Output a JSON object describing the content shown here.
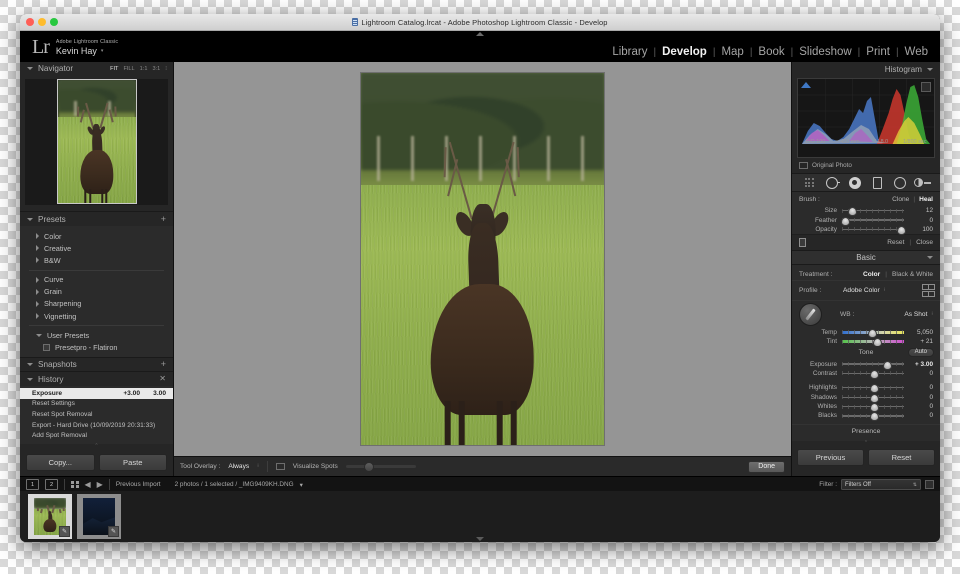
{
  "window": {
    "title": "Lightroom Catalog.lrcat - Adobe Photoshop Lightroom Classic - Develop"
  },
  "identity": {
    "logo": "Lr",
    "app_name": "Adobe Lightroom Classic",
    "user": "Kevin Hay",
    "caret": "▾"
  },
  "modules": [
    {
      "label": "Library",
      "active": false
    },
    {
      "label": "Develop",
      "active": true
    },
    {
      "label": "Map",
      "active": false
    },
    {
      "label": "Book",
      "active": false
    },
    {
      "label": "Slideshow",
      "active": false
    },
    {
      "label": "Print",
      "active": false
    },
    {
      "label": "Web",
      "active": false
    }
  ],
  "navigator": {
    "title": "Navigator",
    "zooms": [
      "FIT",
      "FILL",
      "1:1",
      "3:1"
    ],
    "active_zoom": "FIT"
  },
  "presets": {
    "title": "Presets",
    "add_label": "+",
    "groups": [
      {
        "label": "Color"
      },
      {
        "label": "Creative"
      },
      {
        "label": "B&W"
      },
      {
        "label": "Curve"
      },
      {
        "label": "Grain"
      },
      {
        "label": "Sharpening"
      },
      {
        "label": "Vignetting"
      }
    ],
    "user_presets_label": "User Presets",
    "user_presets": [
      {
        "label": "Presetpro - Flatiron"
      }
    ]
  },
  "snapshots": {
    "title": "Snapshots",
    "add_label": "+"
  },
  "history": {
    "title": "History",
    "close_label": "✕",
    "items": [
      {
        "name": "Exposure",
        "delta": "+3.00",
        "value": "3.00",
        "selected": true
      },
      {
        "name": "Reset Settings",
        "delta": "",
        "value": "",
        "selected": false
      },
      {
        "name": "Reset Spot Removal",
        "delta": "",
        "value": "",
        "selected": false
      },
      {
        "name": "Export - Hard Drive (10/09/2019 20:31:33)",
        "delta": "",
        "value": "",
        "selected": false
      },
      {
        "name": "Add Spot Removal",
        "delta": "",
        "value": "",
        "selected": false
      }
    ]
  },
  "copy_paste": {
    "copy": "Copy...",
    "paste": "Paste"
  },
  "toolbar": {
    "tool_overlay_label": "Tool Overlay :",
    "tool_overlay_value": "Always",
    "visualize_spots_label": "Visualize Spots",
    "visualize_spots_checked": false,
    "visualize_spots_slider": 33,
    "done_label": "Done"
  },
  "histogram": {
    "title": "Histogram",
    "iso": "ISO 100",
    "focal": "450 mm",
    "aperture": "f / 8.0",
    "shutter": "1/800 sec",
    "original_photo_label": "Original Photo"
  },
  "tools": {
    "icons": [
      "crop-grid-icon",
      "spot-removal-icon",
      "red-eye-icon",
      "graduated-filter-icon",
      "radial-filter-icon",
      "adjustment-brush-icon"
    ]
  },
  "brush": {
    "label": "Brush :",
    "modes": [
      {
        "label": "Clone",
        "active": false
      },
      {
        "label": "Heal",
        "active": true
      }
    ],
    "sliders": [
      {
        "label": "Size",
        "value": "12",
        "pos": 16
      },
      {
        "label": "Feather",
        "value": "0",
        "pos": 4
      },
      {
        "label": "Opacity",
        "value": "100",
        "pos": 94
      }
    ],
    "reset_label": "Reset",
    "close_label": "Close"
  },
  "basic": {
    "title": "Basic",
    "treatment_label": "Treatment :",
    "treatments": [
      {
        "label": "Color",
        "active": true
      },
      {
        "label": "Black & White",
        "active": false
      }
    ],
    "profile_label": "Profile :",
    "profile_value": "Adobe Color",
    "wb_label": "WB :",
    "wb_value": "As Shot",
    "wb_sliders": [
      {
        "label": "Temp",
        "value": "5,050",
        "pos": 48
      },
      {
        "label": "Tint",
        "value": "+ 21",
        "pos": 55
      }
    ],
    "tone_label": "Tone",
    "auto_label": "Auto",
    "tone_sliders": [
      {
        "label": "Exposure",
        "value": "+ 3.00",
        "pos": 72
      },
      {
        "label": "Contrast",
        "value": "0",
        "pos": 50
      },
      {
        "label": "Highlights",
        "value": "0",
        "pos": 50
      },
      {
        "label": "Shadows",
        "value": "0",
        "pos": 50
      },
      {
        "label": "Whites",
        "value": "0",
        "pos": 50
      },
      {
        "label": "Blacks",
        "value": "0",
        "pos": 50
      }
    ],
    "presence_label": "Presence"
  },
  "prev_reset": {
    "previous": "Previous",
    "reset": "Reset"
  },
  "filmstrip": {
    "badge_1": "1",
    "badge_2": "2",
    "source": "Previous Import",
    "status": "2 photos / 1 selected / _IMG9409KH.DNG",
    "status_caret": "▾",
    "filter_label": "Filter :",
    "filter_value": "Filters Off",
    "thumbs": [
      {
        "name": "deer-photo",
        "selected": true
      },
      {
        "name": "night-landscape-photo",
        "selected": false
      }
    ]
  },
  "colors": {
    "accent_blue": "#3f78c4",
    "panel_bg": "#262626",
    "canvas_gray": "#959595"
  }
}
